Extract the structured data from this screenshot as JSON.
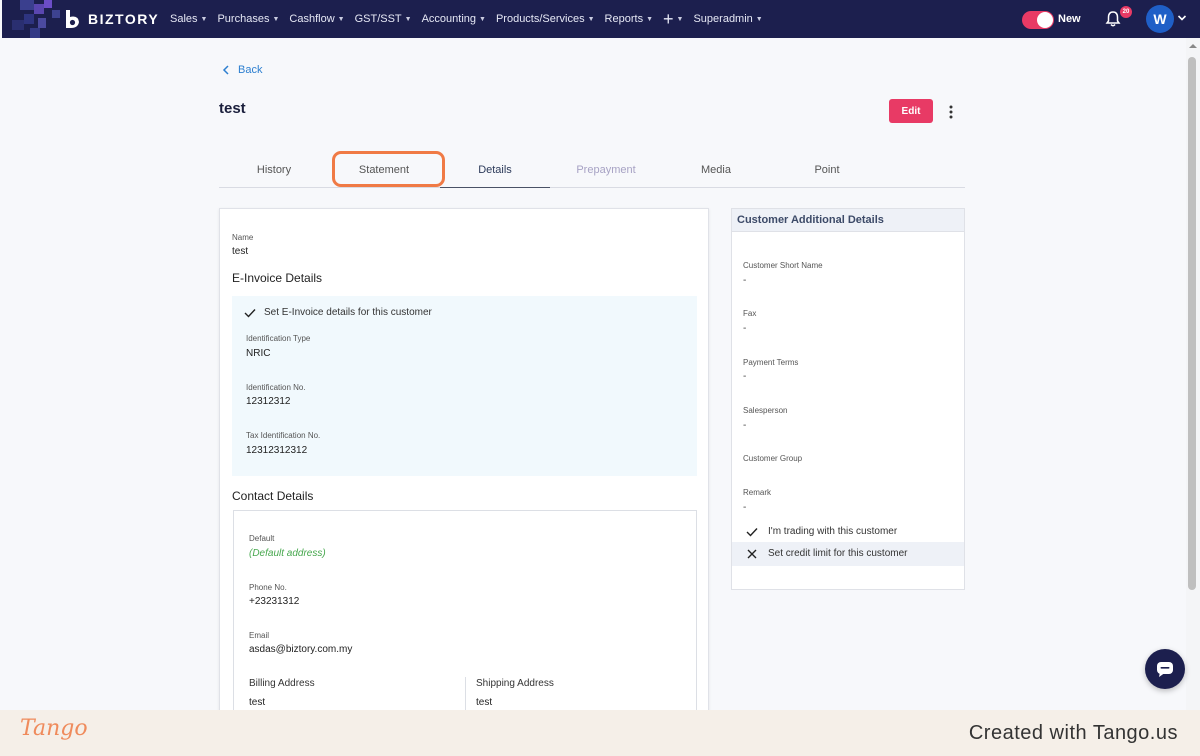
{
  "nav": {
    "brand": "BIZTORY",
    "menu": [
      {
        "label": "Sales"
      },
      {
        "label": "Purchases"
      },
      {
        "label": "Cashflow"
      },
      {
        "label": "GST/SST"
      },
      {
        "label": "Accounting"
      },
      {
        "label": "Products/Services"
      },
      {
        "label": "Reports"
      },
      {
        "label": "+"
      },
      {
        "label": "Superadmin"
      }
    ],
    "toggle_label": "New",
    "notification_count": "20",
    "avatar_initial": "W",
    "colors": {
      "bar": "#1c1f4e",
      "accent": "#e83a65",
      "avatar": "#1f5fc7"
    }
  },
  "page": {
    "back_label": "Back",
    "title": "test",
    "edit_label": "Edit"
  },
  "tabs": [
    {
      "label": "History"
    },
    {
      "label": "Statement"
    },
    {
      "label": "Details"
    },
    {
      "label": "Prepayment"
    },
    {
      "label": "Media"
    },
    {
      "label": "Point"
    }
  ],
  "details": {
    "name_label": "Name",
    "name_value": "test",
    "einvoice_title": "E-Invoice Details",
    "einvoice_check": "Set E-Invoice details for this customer",
    "id_type_label": "Identification Type",
    "id_type_value": "NRIC",
    "id_no_label": "Identification No.",
    "id_no_value": "12312312",
    "tax_id_label": "Tax Identification No.",
    "tax_id_value": "12312312312",
    "contact_title": "Contact Details",
    "default_label": "Default",
    "default_value": "(Default address)",
    "phone_label": "Phone No.",
    "phone_value": "+23231312",
    "email_label": "Email",
    "email_value": "asdas@biztory.com.my",
    "billing_label": "Billing Address",
    "billing_value": "test",
    "shipping_label": "Shipping Address",
    "shipping_value": "test"
  },
  "additional": {
    "title": "Customer Additional Details",
    "short_name_label": "Customer Short Name",
    "short_name_value": "-",
    "fax_label": "Fax",
    "fax_value": "-",
    "payment_terms_label": "Payment Terms",
    "payment_terms_value": "-",
    "salesperson_label": "Salesperson",
    "salesperson_value": "-",
    "customer_group_label": "Customer Group",
    "remark_label": "Remark",
    "remark_value": "-",
    "trading_check": "I'm trading with this customer",
    "credit_check": "Set credit limit for this customer"
  },
  "footer": {
    "brand": "Tango",
    "credit": "Created with Tango.us"
  }
}
